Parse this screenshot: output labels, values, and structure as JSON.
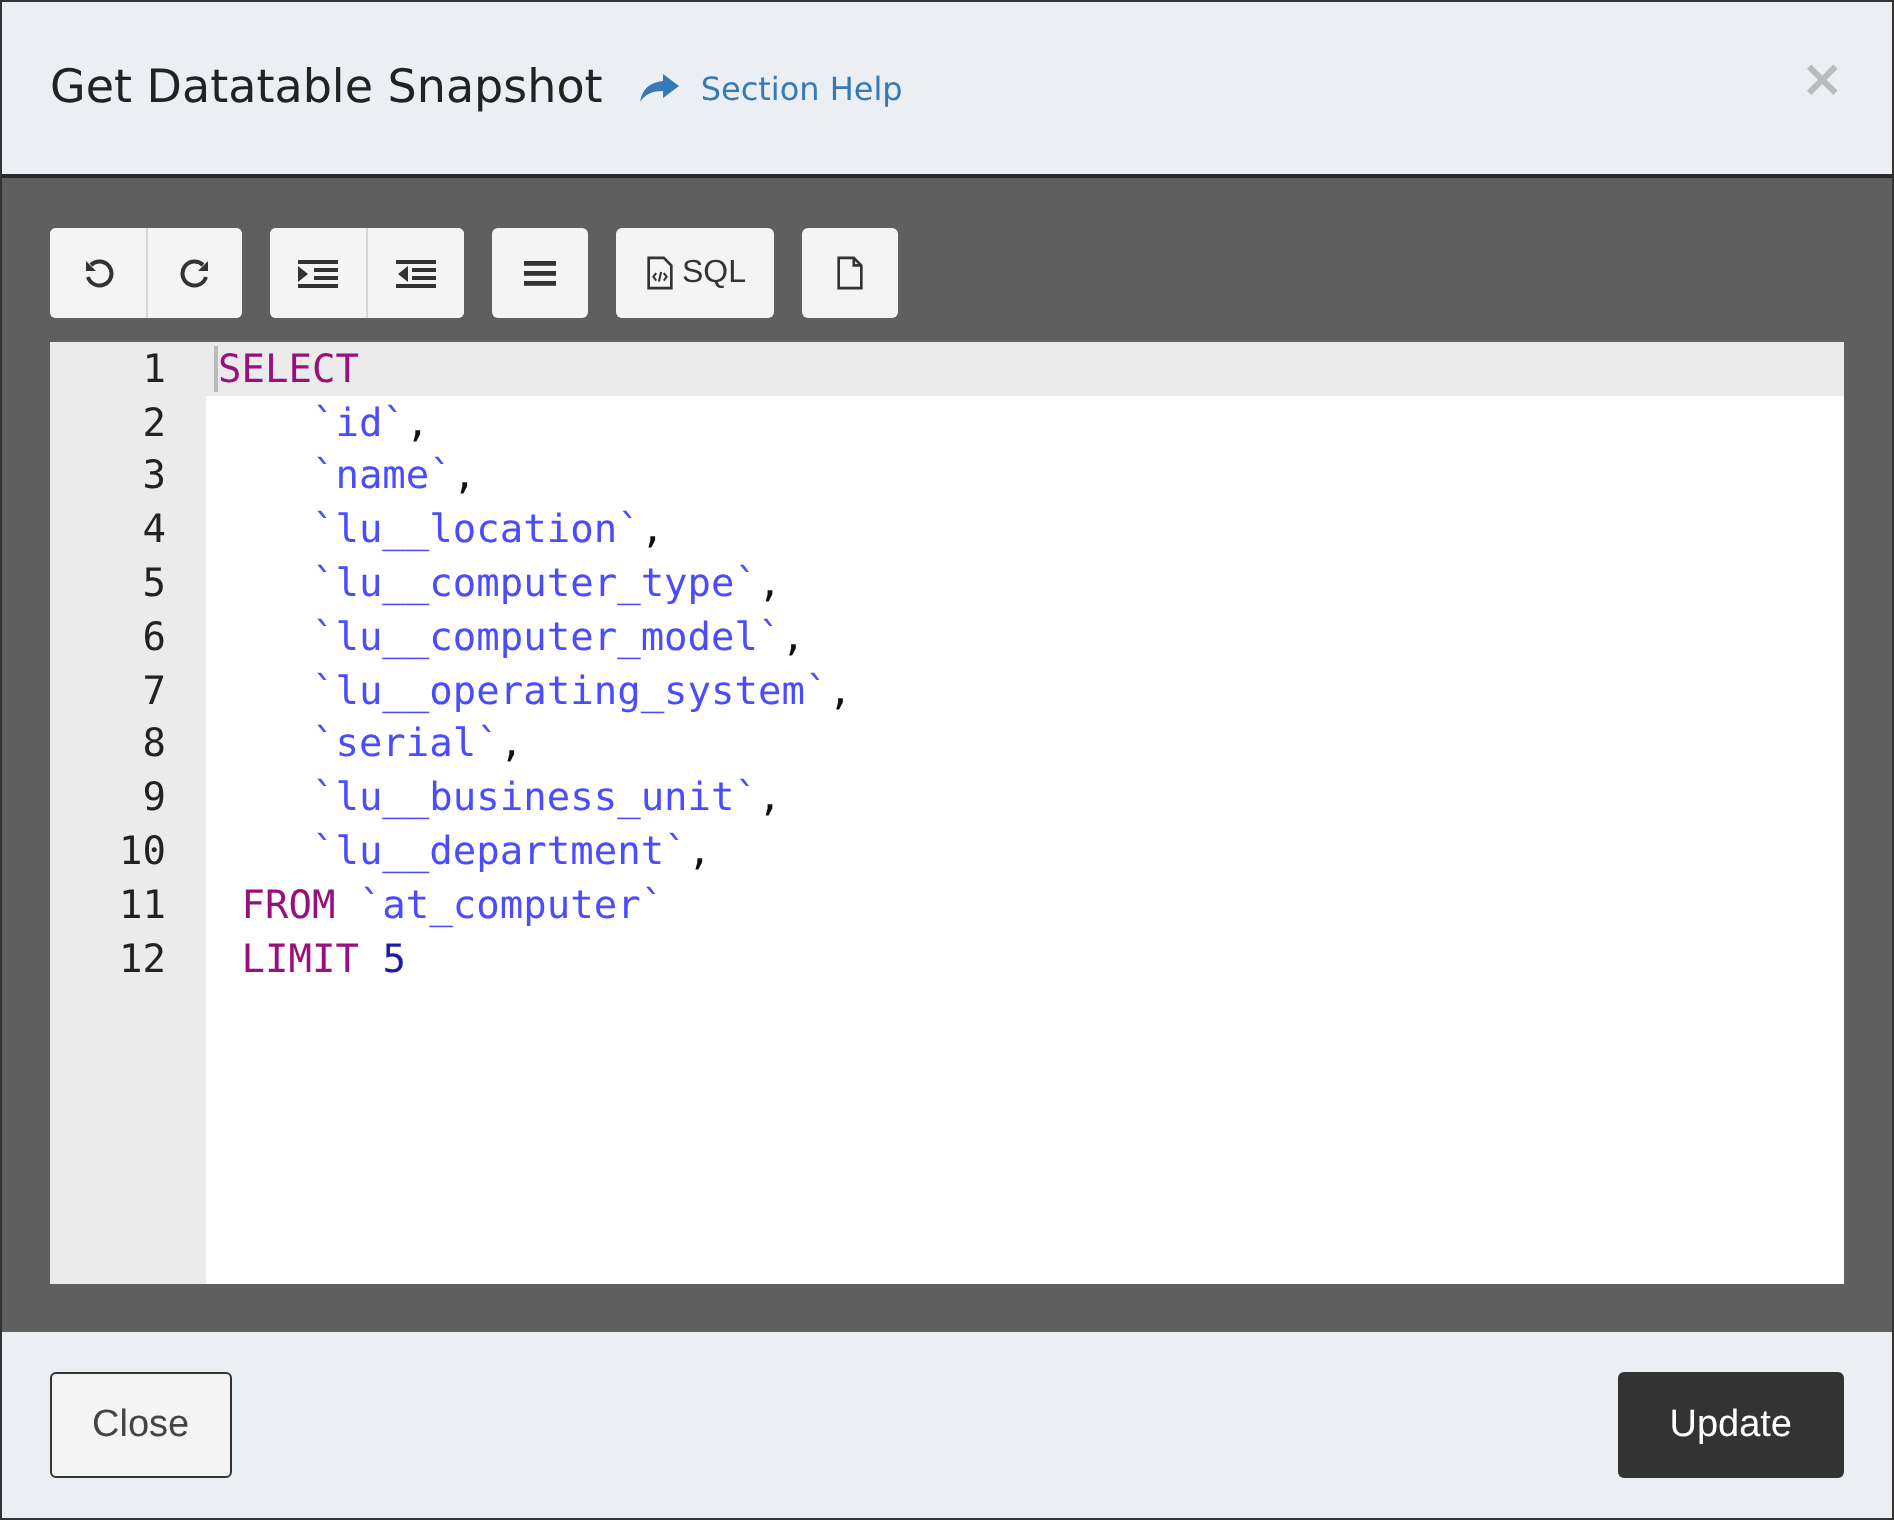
{
  "dialog": {
    "title": "Get Datatable Snapshot",
    "help_link": "Section Help",
    "close_symbol": "×"
  },
  "toolbar": [
    [
      {
        "kind": "undo"
      },
      {
        "kind": "redo"
      }
    ],
    [
      {
        "kind": "indent"
      },
      {
        "kind": "outdent"
      }
    ],
    [
      {
        "kind": "align"
      }
    ],
    [
      {
        "kind": "sql",
        "label": "SQL"
      }
    ],
    [
      {
        "kind": "file"
      }
    ]
  ],
  "editor": {
    "lines": [
      {
        "number": "1",
        "active": true,
        "tokens": [
          {
            "kind": "keyword",
            "text": "SELECT"
          }
        ]
      },
      {
        "number": "2",
        "active": false,
        "tokens": [
          {
            "kind": "identifier",
            "text": "    `id`"
          },
          {
            "kind": "punct",
            "text": ","
          }
        ]
      },
      {
        "number": "3",
        "active": false,
        "tokens": [
          {
            "kind": "identifier",
            "text": "    `name`"
          },
          {
            "kind": "punct",
            "text": ","
          }
        ]
      },
      {
        "number": "4",
        "active": false,
        "tokens": [
          {
            "kind": "identifier",
            "text": "    `lu__location`"
          },
          {
            "kind": "punct",
            "text": ","
          }
        ]
      },
      {
        "number": "5",
        "active": false,
        "tokens": [
          {
            "kind": "identifier",
            "text": "    `lu__computer_type`"
          },
          {
            "kind": "punct",
            "text": ","
          }
        ]
      },
      {
        "number": "6",
        "active": false,
        "tokens": [
          {
            "kind": "identifier",
            "text": "    `lu__computer_model`"
          },
          {
            "kind": "punct",
            "text": ","
          }
        ]
      },
      {
        "number": "7",
        "active": false,
        "tokens": [
          {
            "kind": "identifier",
            "text": "    `lu__operating_system`"
          },
          {
            "kind": "punct",
            "text": ","
          }
        ]
      },
      {
        "number": "8",
        "active": false,
        "tokens": [
          {
            "kind": "identifier",
            "text": "    `serial`"
          },
          {
            "kind": "punct",
            "text": ","
          }
        ]
      },
      {
        "number": "9",
        "active": false,
        "tokens": [
          {
            "kind": "identifier",
            "text": "    `lu__business_unit`"
          },
          {
            "kind": "punct",
            "text": ","
          }
        ]
      },
      {
        "number": "10",
        "active": false,
        "tokens": [
          {
            "kind": "identifier",
            "text": "    `lu__department`"
          },
          {
            "kind": "punct",
            "text": ","
          }
        ]
      },
      {
        "number": "11",
        "active": false,
        "tokens": [
          {
            "kind": "keyword",
            "text": " FROM"
          },
          {
            "kind": "identifier",
            "text": " `at_computer`"
          }
        ]
      },
      {
        "number": "12",
        "active": false,
        "tokens": [
          {
            "kind": "keyword",
            "text": " LIMIT"
          },
          {
            "kind": "number",
            "text": " 5"
          }
        ]
      }
    ]
  },
  "footer": {
    "buttons": [
      {
        "label": "Close",
        "kind": "secondary"
      },
      {
        "label": "Update",
        "kind": "primary"
      }
    ]
  }
}
